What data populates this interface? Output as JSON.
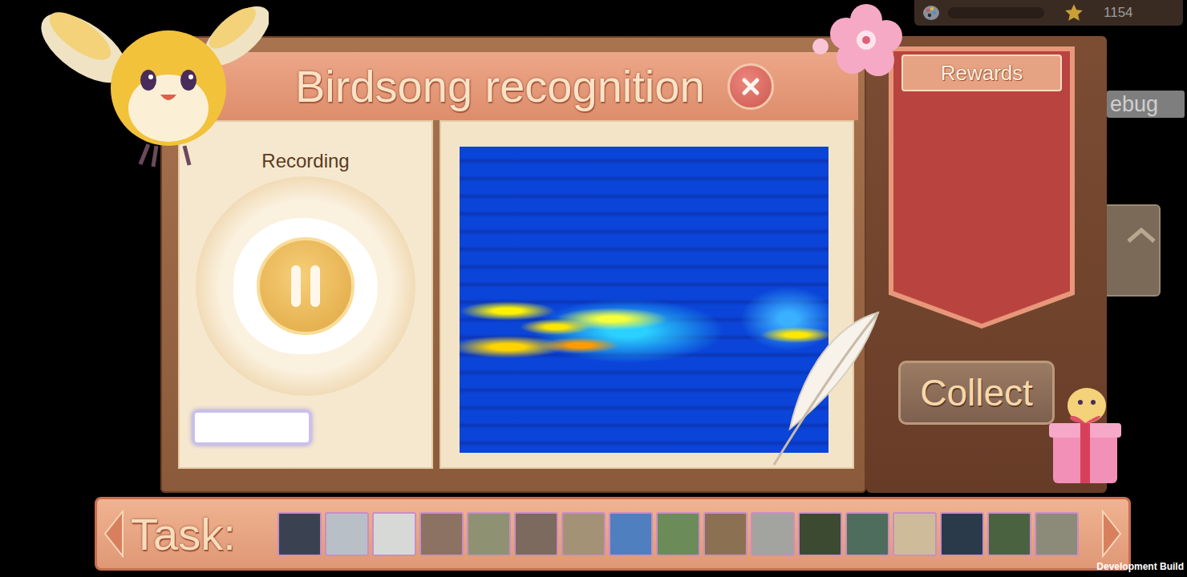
{
  "hud": {
    "score": "1154",
    "progress_level": 0
  },
  "side_buttons": {
    "debug_label": "ebug"
  },
  "dialog": {
    "title": "Birdsong recognition"
  },
  "recorder": {
    "label": "Recording",
    "recording": true
  },
  "rewards": {
    "title": "Rewards"
  },
  "collect_button": {
    "label": "Collect"
  },
  "tasks": {
    "label": "Task:",
    "birds": [
      {
        "color": "#3a4252"
      },
      {
        "color": "#b9bfc6"
      },
      {
        "color": "#d6d9d6"
      },
      {
        "color": "#8c7262"
      },
      {
        "color": "#8e9272"
      },
      {
        "color": "#7c6a5e"
      },
      {
        "color": "#a39276"
      },
      {
        "color": "#4f7fbf"
      },
      {
        "color": "#6b8c58"
      },
      {
        "color": "#8b7152"
      },
      {
        "color": "#a3a39f"
      },
      {
        "color": "#3b4a30"
      },
      {
        "color": "#4e6d5c"
      },
      {
        "color": "#cdbb9a"
      },
      {
        "color": "#2b3a4a"
      },
      {
        "color": "#4b6241"
      },
      {
        "color": "#8c8b7a"
      }
    ]
  },
  "footer": {
    "build": "Development Build"
  }
}
